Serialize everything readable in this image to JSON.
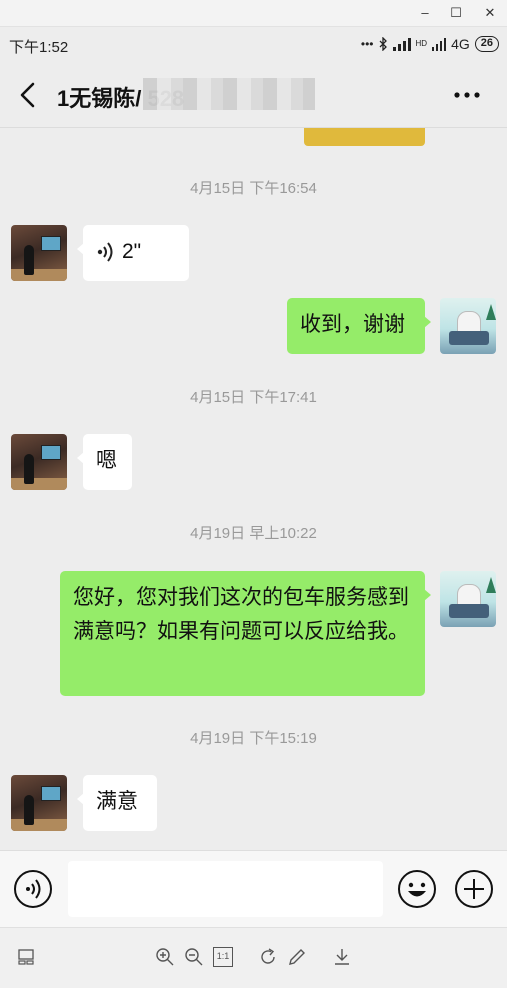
{
  "window": {
    "minimize": "–",
    "maximize": "☐",
    "close": "✕"
  },
  "status_bar": {
    "time": "下午1:52",
    "network": "4G",
    "hd": "HD",
    "battery": "26"
  },
  "nav": {
    "title": "1无锡陈/  528"
  },
  "messages": [
    {
      "timestamp": "4月15日 下午16:54"
    },
    {
      "voice_duration": "2\""
    },
    {
      "text": "收到，谢谢"
    },
    {
      "timestamp": "4月15日 下午17:41"
    },
    {
      "text": "嗯"
    },
    {
      "timestamp": "4月19日 早上10:22"
    },
    {
      "text": "您好，您对我们这次的包车服务感到满意吗？如果有问题可以反应给我。"
    },
    {
      "timestamp": "4月19日 下午15:19"
    },
    {
      "text": "满意"
    }
  ],
  "input": {
    "value": ""
  },
  "viewer_toolbar": {
    "actual_size": "1:1"
  },
  "colors": {
    "outgoing_bubble": "#95ec69",
    "incoming_bubble": "#ffffff",
    "background": "#ededed",
    "timestamp_text": "#999999"
  }
}
